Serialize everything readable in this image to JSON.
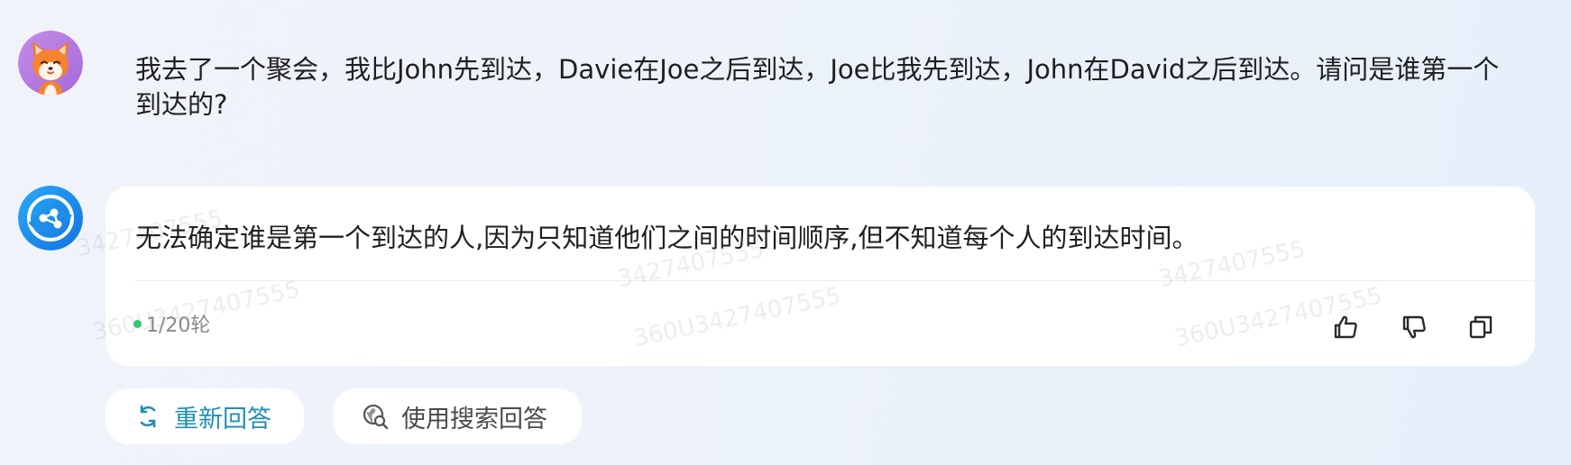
{
  "conversation": {
    "user_message": "我去了一个聚会，我比John先到达，Davie在Joe之后到达，Joe比我先到达，John在David之后到达。请问是谁第一个到达的?",
    "reply": {
      "text": "无法确定谁是第一个到达的人,因为只知道他们之间的时间顺序,但不知道每个人的到达时间。",
      "round_count": "1/20轮",
      "status_color": "#2ecc71",
      "actions": [
        {
          "name": "like",
          "icon": "thumbs-up-icon"
        },
        {
          "name": "dislike",
          "icon": "thumbs-down-icon"
        },
        {
          "name": "copy",
          "icon": "copy-icon"
        }
      ]
    }
  },
  "avatars": {
    "user": "fox-avatar",
    "assistant": "assistant-logo"
  },
  "watermarks": [
    "3427407555",
    "360U3427407555",
    "3427407555",
    "360U3427407555",
    "3427407555",
    "360U3427407555"
  ],
  "actions": {
    "regenerate_label": "重新回答",
    "search_answer_label": "使用搜索回答"
  },
  "colors": {
    "accent": "#1f8fb0",
    "user_avatar_bg": "#b77ae0",
    "assistant_avatar_bg": "#1e8fe8"
  }
}
